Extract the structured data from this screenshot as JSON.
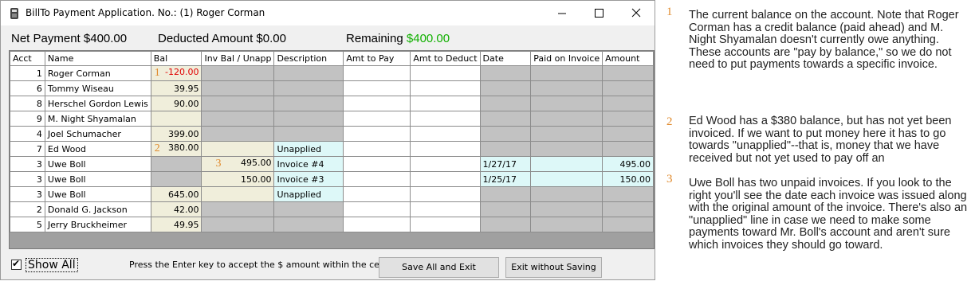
{
  "window": {
    "title": "BillTo Payment Application. No.: (1) Roger Corman",
    "minimize_glyph": "—",
    "maximize_glyph": "☐",
    "close_glyph": "✕"
  },
  "summary": {
    "net_label": "Net Payment",
    "net_value": "$400.00",
    "deducted_label": "Deducted Amount",
    "deducted_value": "$0.00",
    "remaining_label": "Remaining",
    "remaining_value": "$400.00",
    "remaining_color": "#11b000"
  },
  "grid": {
    "columns": [
      "Acct",
      "Name",
      "Bal",
      "Inv Bal / Unapp",
      "Description",
      "Amt to Pay",
      "Amt to Deduct",
      "Date",
      "Paid on Invoice",
      "Amount"
    ],
    "rows": [
      {
        "acct": "1",
        "name": "Roger Corman",
        "callout": "1",
        "bal": "-120.00",
        "inv": "",
        "desc": "",
        "date": "",
        "paid": "",
        "amount": ""
      },
      {
        "acct": "6",
        "name": "Tommy Wiseau",
        "callout": "",
        "bal": "39.95",
        "inv": "",
        "desc": "",
        "date": "",
        "paid": "",
        "amount": ""
      },
      {
        "acct": "8",
        "name": "Herschel Gordon Lewis",
        "callout": "",
        "bal": "90.00",
        "inv": "",
        "desc": "",
        "date": "",
        "paid": "",
        "amount": ""
      },
      {
        "acct": "9",
        "name": "M. Night Shyamalan",
        "callout": "",
        "bal": "",
        "inv": "",
        "desc": "",
        "date": "",
        "paid": "",
        "amount": ""
      },
      {
        "acct": "4",
        "name": "Joel Schumacher",
        "callout": "",
        "bal": "399.00",
        "inv": "",
        "desc": "",
        "date": "",
        "paid": "",
        "amount": ""
      },
      {
        "acct": "7",
        "name": "Ed Wood",
        "callout": "2",
        "bal": "380.00",
        "inv": "",
        "desc": "Unapplied",
        "date": "",
        "paid": "",
        "amount": ""
      },
      {
        "acct": "3",
        "name": "Uwe Boll",
        "callout": "3",
        "bal": "",
        "inv": "495.00",
        "desc": "Invoice #4",
        "date": "1/27/17",
        "paid": "",
        "amount": "495.00"
      },
      {
        "acct": "3",
        "name": "Uwe Boll",
        "callout": "",
        "bal": "",
        "inv": "150.00",
        "desc": "Invoice #3",
        "date": "1/25/17",
        "paid": "",
        "amount": "150.00"
      },
      {
        "acct": "3",
        "name": "Uwe Boll",
        "callout": "",
        "bal": "645.00",
        "inv": "",
        "desc": "Unapplied",
        "date": "",
        "paid": "",
        "amount": ""
      },
      {
        "acct": "2",
        "name": "Donald G. Jackson",
        "callout": "",
        "bal": "42.00",
        "inv": "",
        "desc": "",
        "date": "",
        "paid": "",
        "amount": ""
      },
      {
        "acct": "5",
        "name": "Jerry Bruckheimer",
        "callout": "",
        "bal": "49.95",
        "inv": "",
        "desc": "",
        "date": "",
        "paid": "",
        "amount": ""
      }
    ]
  },
  "footer": {
    "show_all_label": "Show All",
    "show_all_checked": "✔",
    "hint": "Press the Enter key to accept the $ amount within the cell",
    "save_button": "Save All and Exit",
    "exit_button": "Exit without Saving"
  },
  "notes": [
    {
      "num": "1",
      "text": "The current balance on the account. Note that Roger Corman has a credit balance (paid ahead) and M. Night Shyamalan doesn't currently owe anything. These accounts are \"pay by balance,\" so we do not need to put payments towards a specific invoice."
    },
    {
      "num": "2",
      "text": "Ed Wood has a $380 balance, but has not yet been invoiced. If we want to put money here it has to go towards \"unapplied\"--that is, money that we have received but not yet used to pay off an"
    },
    {
      "num": "3",
      "text": "Uwe Boll has two unpaid invoices. If you look to the right you'll see the date each invoice was issued along with the original amount of the invoice. There's also an \"unapplied\" line in case we need to make some payments toward Mr. Boll's account and aren't sure which invoices they should go toward."
    }
  ],
  "colors": {
    "callout": "#e08a2c",
    "negative": "#e00000",
    "unapplied_cell": "#ddf8f8",
    "balance_cell": "#f0eedb",
    "inactive_cell": "#c2c2c2"
  }
}
